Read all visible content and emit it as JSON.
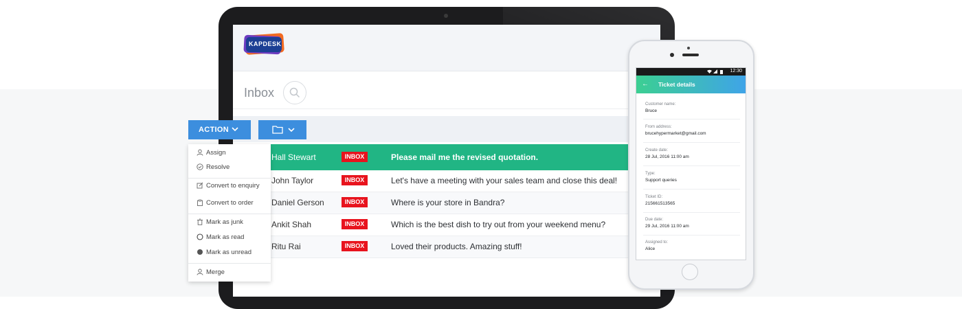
{
  "app": {
    "logo_text": "KAPDESK",
    "inbox_title": "Inbox"
  },
  "toolbar": {
    "action_label": "ACTION"
  },
  "action_menu": [
    {
      "label": "Assign",
      "icon": "user-icon"
    },
    {
      "label": "Resolve",
      "icon": "check-circle-icon"
    },
    {
      "label": "Convert to enquiry",
      "icon": "edit-icon"
    },
    {
      "label": "Convert to order",
      "icon": "clipboard-icon"
    },
    {
      "label": "Mark as junk",
      "icon": "trash-icon"
    },
    {
      "label": "Mark as read",
      "icon": "circle-outline-icon"
    },
    {
      "label": "Mark as unread",
      "icon": "circle-filled-icon"
    },
    {
      "label": "Merge",
      "icon": "user-icon"
    }
  ],
  "tickets": [
    {
      "name": "Hall Stewart",
      "badge": "INBOX",
      "subject": "Please mail me the revised quotation."
    },
    {
      "name": "John Taylor",
      "badge": "INBOX",
      "subject": "Let's have a meeting with your sales team and close this deal!"
    },
    {
      "name": "Daniel Gerson",
      "badge": "INBOX",
      "subject": "Where is your store in Bandra?"
    },
    {
      "name": "Ankit Shah",
      "badge": "INBOX",
      "subject": "Which is the best dish to try out from your weekend menu?"
    },
    {
      "name": "Ritu Rai",
      "badge": "INBOX",
      "subject": "Loved their products. Amazing stuff!"
    }
  ],
  "phone": {
    "status_time": "12:30",
    "back_glyph": "←",
    "title": "Ticket details",
    "fields": [
      {
        "label": "Customer name:",
        "value": "Bruce"
      },
      {
        "label": "From address:",
        "value": "brucehypermarket@gmail.com"
      },
      {
        "label": "Create date:",
        "value": "28 Jul, 2016 11:00 am"
      },
      {
        "label": "Type:",
        "value": "Support queries"
      },
      {
        "label": "Ticket ID:",
        "value": "215661513565"
      },
      {
        "label": "Due date:",
        "value": "29 Jul, 2016 11:00 am"
      },
      {
        "label": "Assigned to:",
        "value": "Alice"
      }
    ]
  },
  "colors": {
    "selected_row": "#21b584",
    "button_blue": "#3c8ede",
    "badge_red": "#e8131d"
  }
}
